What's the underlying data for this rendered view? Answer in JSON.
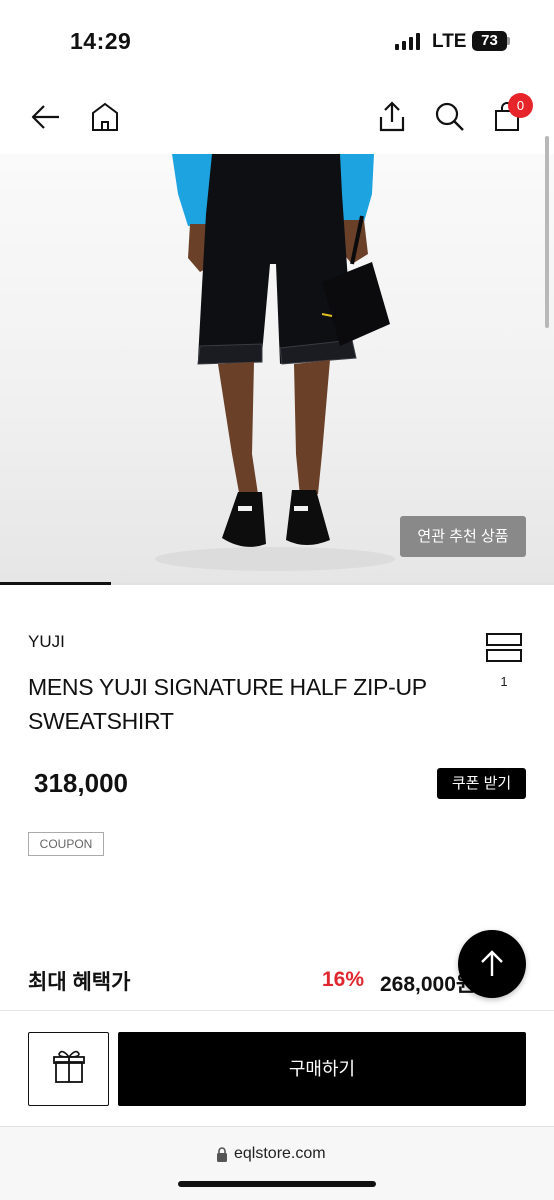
{
  "status_bar": {
    "time": "14:29",
    "network": "LTE",
    "battery": "73"
  },
  "nav": {
    "back_icon": "arrow-left-icon",
    "home_icon": "home-icon",
    "share_icon": "share-icon",
    "search_icon": "search-icon",
    "cart_icon": "shopping-bag-icon",
    "cart_count": "0"
  },
  "gallery": {
    "related_button": "연관 추천 상품",
    "progress_fraction": 0.2
  },
  "product": {
    "brand": "YUJI",
    "name": "MENS YUJI SIGNATURE HALF ZIP-UP SWEATSHIRT",
    "compare_count": "1",
    "price": "318,000",
    "coupon_button": "쿠폰 받기",
    "coupon_tag": "COUPON"
  },
  "benefit": {
    "label": "최대 혜택가",
    "discount_rate": "16%",
    "price": "268,000원~"
  },
  "bottom_bar": {
    "gift_icon": "gift-icon",
    "buy_button": "구매하기"
  },
  "browser": {
    "url": "eqlstore.com"
  },
  "colors": {
    "accent_red": "#e0272e",
    "badge_red": "#e8242b",
    "primary_black": "#000000"
  }
}
